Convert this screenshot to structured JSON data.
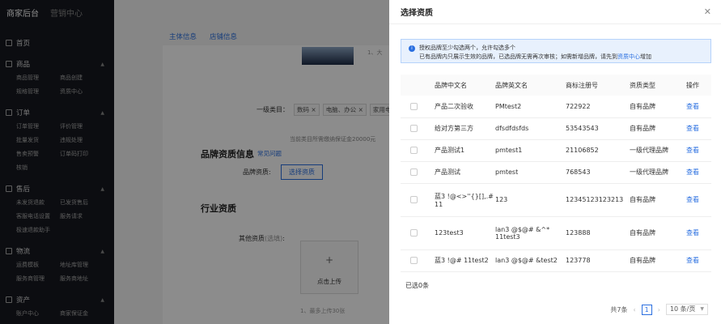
{
  "topnav": {
    "merchant": "商家后台",
    "marketing": "营销中心"
  },
  "sidebar": {
    "home": "首页",
    "sections": [
      {
        "label": "商品",
        "items": [
          "商品管理",
          "商品创建",
          "规格管理",
          "资质中心"
        ]
      },
      {
        "label": "订单",
        "items": [
          "订单管理",
          "评价管理",
          "批量发货",
          "违规处理",
          "售卖预警",
          "订单码打印",
          "核销"
        ]
      },
      {
        "label": "售后",
        "items": [
          "未发货退款",
          "已发货售后",
          "客服电话设置",
          "服务请求",
          "极速退款助手"
        ]
      },
      {
        "label": "物流",
        "items": [
          "运费模板",
          "地址库管理",
          "服务商管理",
          "服务商地址"
        ]
      },
      {
        "label": "资产",
        "items": [
          "账户中心",
          "商家保证金"
        ]
      }
    ]
  },
  "background": {
    "tabs": [
      "主体信息",
      "店铺信息"
    ],
    "note_top": "1、大",
    "category_label": "一级类目：",
    "category_tags": [
      "数码",
      "电脑、办公",
      "家用电"
    ],
    "deposit_note": "当前类目所需缴纳保证金20000元",
    "brand_section_title": "品牌资质信息",
    "faq_link": "常见问题",
    "brand_label": "品牌资质:",
    "brand_button": "选择资质",
    "industry_title": "行业资质",
    "other_label": "其他资质",
    "other_optional": "(选填)",
    "other_colon": ":",
    "upload_plus": "+",
    "upload_label": "点击上传",
    "note_bottom": "1、最多上传30张"
  },
  "drawer": {
    "title": "选择资质",
    "close": "✕",
    "alert": {
      "line1": "授权品牌至少勾选两个，允许勾选多个",
      "line2_pre": "已有品牌内只展示生效的品牌，已选品牌无需再次审核；如需新增品牌，请先到",
      "line2_link": "资质中心",
      "line2_post": "增加"
    },
    "columns": [
      "品牌中文名",
      "品牌英文名",
      "商标注册号",
      "资质类型",
      "操作"
    ],
    "rows": [
      {
        "cn": "产品二次验收",
        "en": "PMtest2",
        "reg": "722922",
        "type": "自有品牌",
        "action": "查看"
      },
      {
        "cn": "给对方第三方",
        "en": "dfsdfdsfds",
        "reg": "53543543",
        "type": "自有品牌",
        "action": "查看"
      },
      {
        "cn": "产品测试1",
        "en": "pmtest1",
        "reg": "21106852",
        "type": "一级代理品牌",
        "action": "查看"
      },
      {
        "cn": "产品测试",
        "en": "pmtest",
        "reg": "768543",
        "type": "一级代理品牌",
        "action": "查看"
      },
      {
        "cn": "蓝3 !@<>''{}[],.# 11",
        "en": "123",
        "reg": "12345123123213",
        "type": "自有品牌",
        "action": "查看"
      },
      {
        "cn": "123test3",
        "en": "lan3 @$@# &^* 11test3",
        "reg": "123888",
        "type": "自有品牌",
        "action": "查看"
      },
      {
        "cn": "蓝3 !@# 11test2",
        "en": "lan3 @$@# &test2",
        "reg": "123778",
        "type": "自有品牌",
        "action": "查看"
      }
    ],
    "selected": "已选0条",
    "pagination": {
      "total": "共7条",
      "prev": "‹",
      "page": "1",
      "next": "›",
      "size": "10 条/页"
    }
  },
  "colors": {
    "accent": "#2a6fe0",
    "sidebar_bg": "#16181f"
  }
}
